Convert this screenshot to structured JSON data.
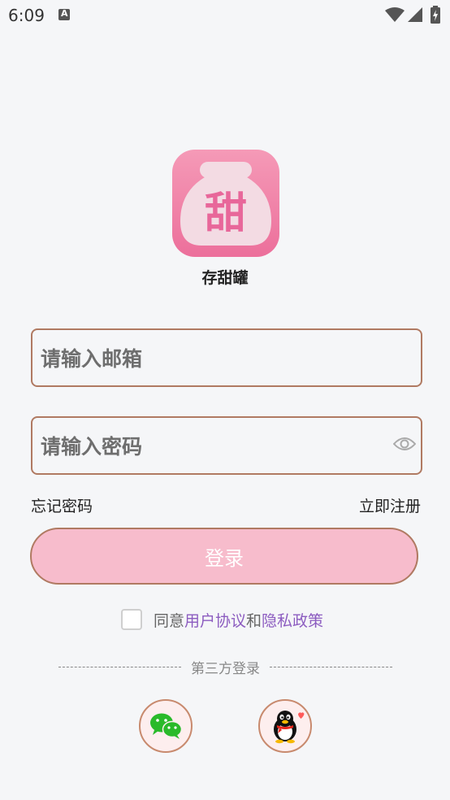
{
  "status_bar": {
    "time": "6:09",
    "notification_letter": "A"
  },
  "app": {
    "logo_char": "甜",
    "name": "存甜罐"
  },
  "form": {
    "email_placeholder": "请输入邮箱",
    "password_placeholder": "请输入密码"
  },
  "links": {
    "forgot_password": "忘记密码",
    "register": "立即注册"
  },
  "login_button": "登录",
  "agreement": {
    "prefix": "同意",
    "user_agreement": "用户协议",
    "conjunction": "和",
    "privacy_policy": "隐私政策",
    "checked": false
  },
  "third_party": {
    "label": "第三方登录",
    "options": [
      "wechat",
      "qq"
    ]
  },
  "colors": {
    "accent": "#f7bccc",
    "border": "#b07a62",
    "link": "#8c5cc0",
    "logo": "#ec6f9b"
  }
}
